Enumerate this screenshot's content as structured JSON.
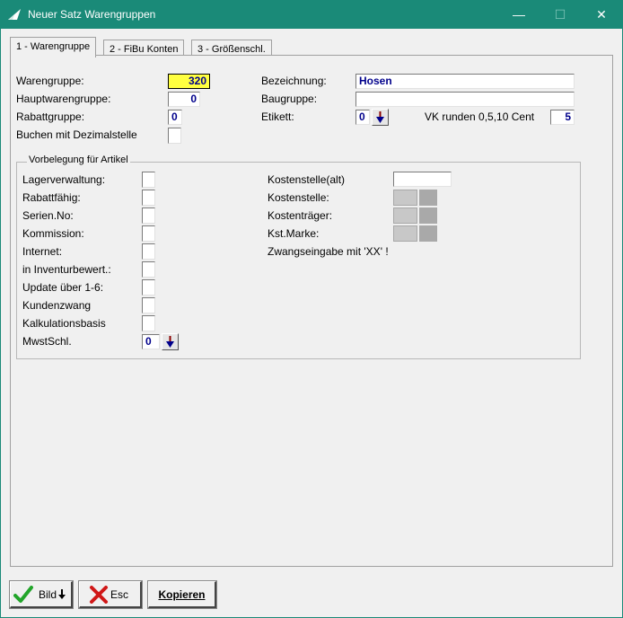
{
  "window": {
    "title": "Neuer Satz  Warengruppen",
    "minimize": "—",
    "maximize": "☐",
    "close": "✕"
  },
  "tabs": [
    {
      "label": "1 - Warengruppe",
      "active": true
    },
    {
      "label": "2 - FiBu Konten",
      "active": false
    },
    {
      "label": "3 - Größenschl.",
      "active": false
    }
  ],
  "form": {
    "warengruppe_label": "Warengruppe:",
    "warengruppe_value": "320",
    "hauptwarengruppe_label": "Hauptwarengruppe:",
    "hauptwarengruppe_value": "0",
    "rabattgruppe_label": "Rabattgruppe:",
    "rabattgruppe_value": "0",
    "dezimalstelle_label": "Buchen mit Dezimalstelle",
    "bezeichnung_label": "Bezeichnung:",
    "bezeichnung_value": "Hosen",
    "baugruppe_label": "Baugruppe:",
    "baugruppe_value": "",
    "etikett_label": "Etikett:",
    "etikett_value": "0",
    "vk_runden_label": "VK runden 0,5,10 Cent",
    "vk_runden_value": "5"
  },
  "group": {
    "title": "Vorbelegung für Artikel",
    "checkbox_labels": [
      "Lagerverwaltung:",
      "Rabattfähig:",
      "Serien.No:",
      "Kommission:",
      "Internet:",
      "in Inventurbewert.:",
      "Update über 1-6:",
      "Kundenzwang",
      "Kalkulationsbasis"
    ],
    "mwst_label": "MwstSchl.",
    "mwst_value": "0",
    "kostenstelle_alt_label": "Kostenstelle(alt)",
    "kostenstelle_label": "Kostenstelle:",
    "kostentraeger_label": "Kostenträger:",
    "kstmarke_label": "Kst.Marke:",
    "zwangseingabe_text": "Zwangseingabe mit 'XX' !"
  },
  "buttons": {
    "bild_label": "Bild",
    "esc_label": "Esc",
    "kopieren_label": "Kopieren"
  },
  "colors": {
    "titlebar": "#1a8a78",
    "highlight_field": "#ffff40",
    "value_text": "#00008b",
    "check_green": "#22a52a",
    "x_red": "#d01818"
  }
}
